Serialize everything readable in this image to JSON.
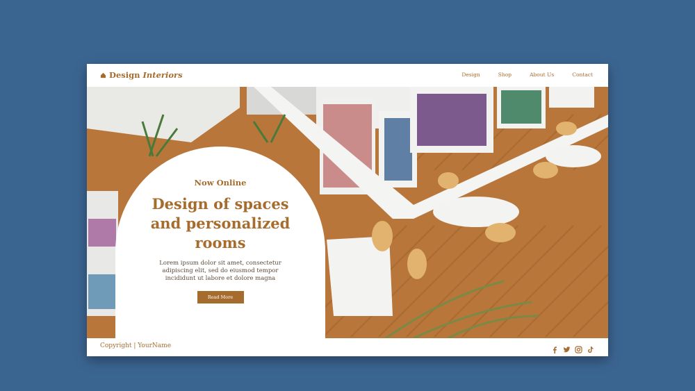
{
  "brand": {
    "name_plain": "Design",
    "name_italic": "Interiors",
    "logo_icon": "home-icon"
  },
  "nav": {
    "items": [
      "Design",
      "Shop",
      "About Us",
      "Contact"
    ]
  },
  "hero": {
    "eyebrow": "Now Online",
    "headline": "Design of spaces and personalized rooms",
    "body": "Lorem ipsum dolor sit amet, consectetur adipiscing elit, sed do eiusmod tempor incididunt ut labore et dolore magna",
    "cta_label": "Read More",
    "image_description_icon": "library-photo"
  },
  "footer": {
    "copyright": "Copyright | YourName",
    "social_icons": [
      "facebook-icon",
      "twitter-icon",
      "instagram-icon",
      "tiktok-icon"
    ]
  },
  "colors": {
    "page_bg": "#3b6591",
    "accent": "#a66c2e",
    "card_bg": "#ffffff"
  }
}
